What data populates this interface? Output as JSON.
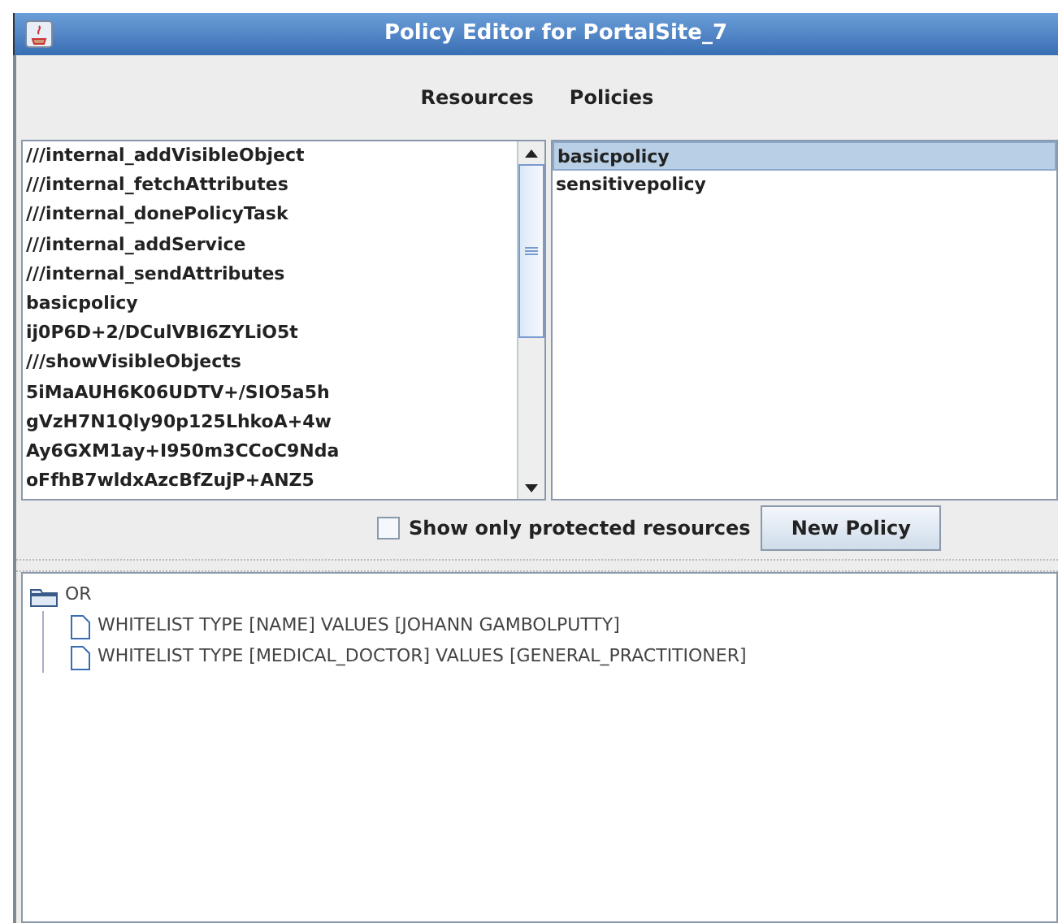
{
  "window": {
    "title": "Policy Editor for PortalSite_7"
  },
  "headings": [
    "Resources",
    "Policies"
  ],
  "resources": [
    {
      "label": "///internal_addVisibleObject",
      "selected": false
    },
    {
      "label": "///internal_fetchAttributes",
      "selected": false
    },
    {
      "label": "///internal_donePolicyTask",
      "selected": false
    },
    {
      "label": "///internal_addService",
      "selected": false
    },
    {
      "label": "///internal_sendAttributes",
      "selected": false
    },
    {
      "label": "basicpolicy",
      "selected": false
    },
    {
      "label": "ij0P6D+2/DCulVBI6ZYLiO5t",
      "selected": false
    },
    {
      "label": "///showVisibleObjects",
      "selected": false
    },
    {
      "label": "5iMaAUH6K06UDTV+/SIO5a5h",
      "selected": false
    },
    {
      "label": "gVzH7N1Qly90p125LhkoA+4w",
      "selected": false
    },
    {
      "label": "Ay6GXM1ay+I950m3CCoC9Nda",
      "selected": false
    },
    {
      "label": "oFfhB7wldxAzcBfZujP+ANZ5",
      "selected": false
    }
  ],
  "policies": [
    {
      "label": "basicpolicy",
      "selected": true
    },
    {
      "label": "sensitivepolicy",
      "selected": false
    }
  ],
  "protected_only": {
    "label": "Show only protected resources",
    "checked": false
  },
  "new_policy_button": "New Policy",
  "tree": {
    "label": "OR",
    "kind": "folder",
    "children": [
      {
        "label": "WHITELIST TYPE [NAME] VALUES [JOHANN GAMBOLPUTTY]",
        "kind": "leaf"
      },
      {
        "label": "WHITELIST TYPE [MEDICAL_DOCTOR] VALUES [GENERAL_PRACTITIONER]",
        "kind": "leaf"
      }
    ]
  }
}
